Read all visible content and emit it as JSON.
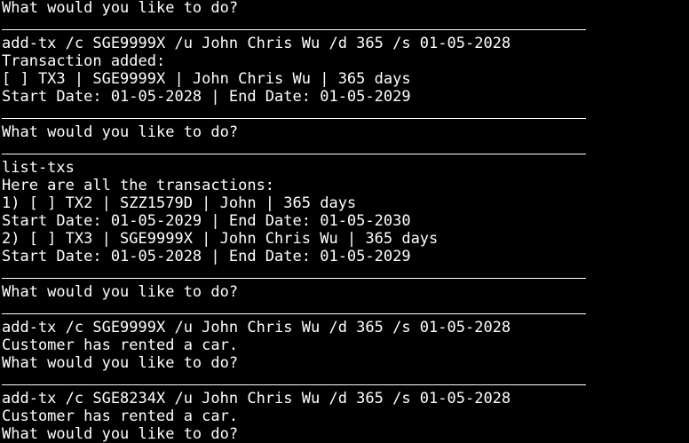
{
  "terminal": {
    "background": "#000000",
    "foreground": "#ffffff",
    "lines": [
      {
        "kind": "text",
        "text": "What would you like to do?"
      },
      {
        "kind": "sep"
      },
      {
        "kind": "text",
        "text": "add-tx /c SGE9999X /u John Chris Wu /d 365 /s 01-05-2028"
      },
      {
        "kind": "text",
        "text": "Transaction added:"
      },
      {
        "kind": "text",
        "text": "[ ] TX3 | SGE9999X | John Chris Wu | 365 days"
      },
      {
        "kind": "text",
        "text": "Start Date: 01-05-2028 | End Date: 01-05-2029"
      },
      {
        "kind": "sep"
      },
      {
        "kind": "text",
        "text": "What would you like to do?"
      },
      {
        "kind": "sep"
      },
      {
        "kind": "text",
        "text": "list-txs"
      },
      {
        "kind": "text",
        "text": "Here are all the transactions:"
      },
      {
        "kind": "text",
        "text": "1) [ ] TX2 | SZZ1579D | John | 365 days"
      },
      {
        "kind": "text",
        "text": "Start Date: 01-05-2029 | End Date: 01-05-2030"
      },
      {
        "kind": "text",
        "text": "2) [ ] TX3 | SGE9999X | John Chris Wu | 365 days"
      },
      {
        "kind": "text",
        "text": "Start Date: 01-05-2028 | End Date: 01-05-2029"
      },
      {
        "kind": "sep"
      },
      {
        "kind": "text",
        "text": "What would you like to do?"
      },
      {
        "kind": "sep"
      },
      {
        "kind": "text",
        "text": "add-tx /c SGE9999X /u John Chris Wu /d 365 /s 01-05-2028"
      },
      {
        "kind": "text",
        "text": "Customer has rented a car."
      },
      {
        "kind": "text",
        "text": "What would you like to do?"
      },
      {
        "kind": "sep"
      },
      {
        "kind": "text",
        "text": "add-tx /c SGE8234X /u John Chris Wu /d 365 /s 01-05-2028"
      },
      {
        "kind": "text",
        "text": "Customer has rented a car."
      },
      {
        "kind": "text",
        "text": "What would you like to do?"
      }
    ]
  }
}
